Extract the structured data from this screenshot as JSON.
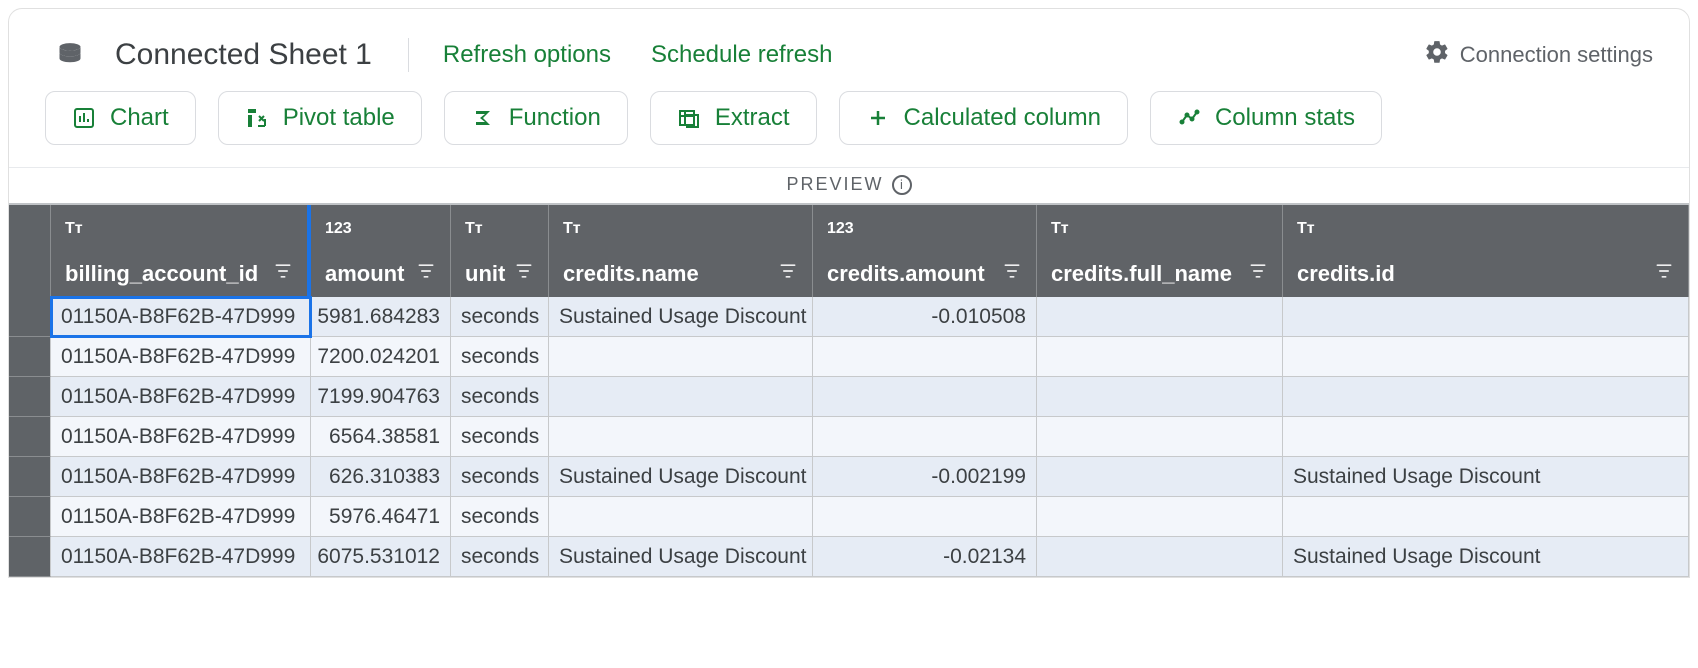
{
  "title": "Connected Sheet 1",
  "links": {
    "refresh_options": "Refresh options",
    "schedule_refresh": "Schedule refresh",
    "connection_settings": "Connection settings"
  },
  "toolbar": {
    "chart": "Chart",
    "pivot": "Pivot table",
    "function": "Function",
    "extract": "Extract",
    "calc_col": "Calculated column",
    "col_stats": "Column stats"
  },
  "preview_label": "PREVIEW",
  "columns": [
    {
      "type": "Tᴛ",
      "name": "billing_account_id",
      "num": false
    },
    {
      "type": "123",
      "name": "amount",
      "num": true
    },
    {
      "type": "Tᴛ",
      "name": "unit",
      "num": false
    },
    {
      "type": "Tᴛ",
      "name": "credits.name",
      "num": false
    },
    {
      "type": "123",
      "name": "credits.amount",
      "num": true
    },
    {
      "type": "Tᴛ",
      "name": "credits.full_name",
      "num": false
    },
    {
      "type": "Tᴛ",
      "name": "credits.id",
      "num": false
    }
  ],
  "rows": [
    [
      "01150A-B8F62B-47D999",
      "5981.684283",
      "seconds",
      "Sustained Usage Discount",
      "-0.010508",
      "",
      ""
    ],
    [
      "01150A-B8F62B-47D999",
      "7200.024201",
      "seconds",
      "",
      "",
      "",
      ""
    ],
    [
      "01150A-B8F62B-47D999",
      "7199.904763",
      "seconds",
      "",
      "",
      "",
      ""
    ],
    [
      "01150A-B8F62B-47D999",
      "6564.38581",
      "seconds",
      "",
      "",
      "",
      ""
    ],
    [
      "01150A-B8F62B-47D999",
      "626.310383",
      "seconds",
      "Sustained Usage Discount",
      "-0.002199",
      "",
      "Sustained Usage Discount"
    ],
    [
      "01150A-B8F62B-47D999",
      "5976.46471",
      "seconds",
      "",
      "",
      "",
      ""
    ],
    [
      "01150A-B8F62B-47D999",
      "6075.531012",
      "seconds",
      "Sustained Usage Discount",
      "-0.02134",
      "",
      "Sustained Usage Discount"
    ]
  ],
  "selected_cell": {
    "row": 0,
    "col": 0
  }
}
